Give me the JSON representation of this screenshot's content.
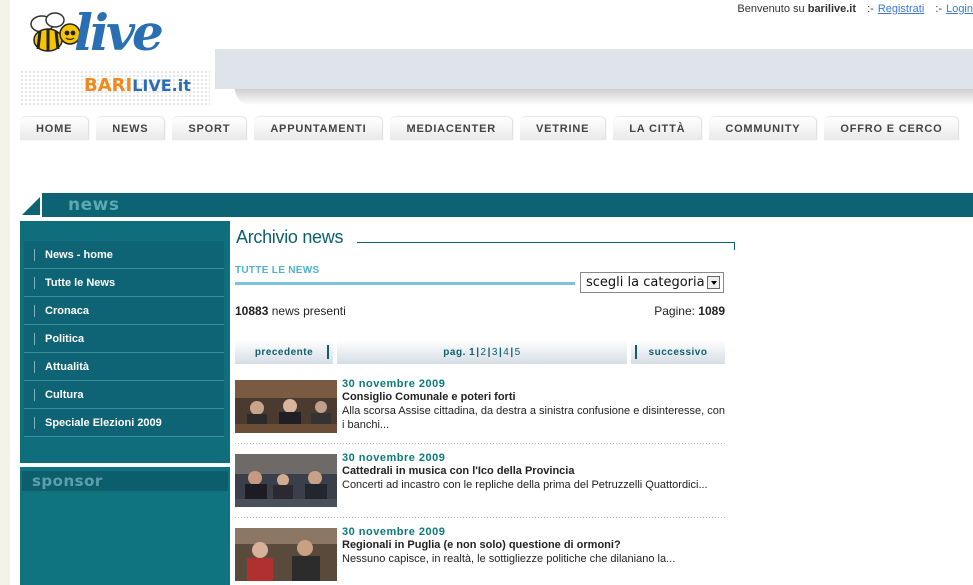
{
  "header": {
    "welcome_prefix": "Benvenuto su",
    "site_name": "barilive.it",
    "register_label": "Registrati",
    "login_label": "Login",
    "logo_text_live": "live",
    "logo_text_bari": "BARI",
    "logo_text_domain": "LIVE.it"
  },
  "nav": {
    "items": [
      "HOME",
      "NEWS",
      "SPORT",
      "APPUNTAMENTI",
      "MEDIACENTER",
      "VETRINE",
      "LA CITTÀ",
      "COMMUNITY",
      "OFFRO E CERCO"
    ]
  },
  "section": {
    "title": "news"
  },
  "sidebar": {
    "items": [
      "News - home",
      "Tutte le News",
      "Cronaca",
      "Politica",
      "Attualità",
      "Cultura",
      "Speciale Elezioni 2009"
    ],
    "sponsor_title": "sponsor"
  },
  "main": {
    "title": "Archivio news",
    "subhead": "TUTTE LE NEWS",
    "category_select": {
      "selected": "scegli la categoria"
    },
    "count_value": "10883",
    "count_suffix": "news presenti",
    "pages_label": "Pagine:",
    "pages_value": "1089",
    "pager": {
      "prev": "precedente",
      "page_prefix": "pag.",
      "pages": [
        "1",
        "2",
        "3",
        "4",
        "5"
      ],
      "next": "successivo"
    },
    "news": [
      {
        "date": "30 novembre 2009",
        "title": "Consiglio Comunale e poteri forti",
        "abstract": "Alla scorsa Assise cittadina, da destra a sinistra confusione e disinteresse, con i banchi..."
      },
      {
        "date": "30 novembre 2009",
        "title": "Cattedrali in musica con l'Ico della Provincia",
        "abstract": "Concerti ad incastro con le repliche della prima del Petruzzelli Quattordici..."
      },
      {
        "date": "30 novembre 2009",
        "title": "Regionali in Puglia (e non solo) questione di ormoni?",
        "abstract": "Nessuno capisce, in realtà, le sottigliezze politiche che dilaniano la..."
      }
    ]
  },
  "colors": {
    "teal": "#0d6273",
    "accent_blue": "#4fb1cc",
    "link": "#3a7ad8",
    "logo_orange": "#f08a1c",
    "logo_blue": "#2a6fb3"
  }
}
